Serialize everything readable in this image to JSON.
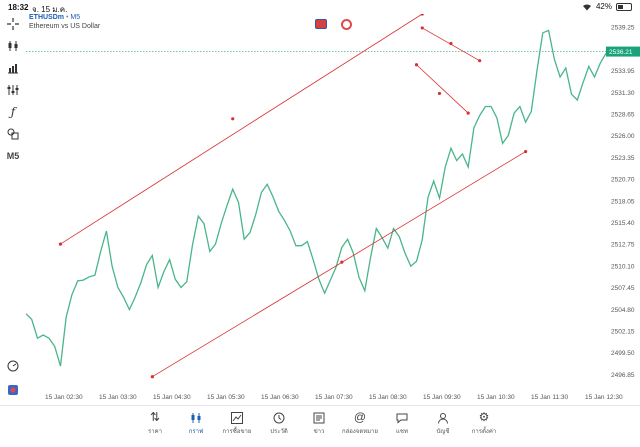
{
  "status_bar": {
    "time": "18:32",
    "date": "จ. 15 ม.ค.",
    "battery": "42%",
    "battery_level": 0.42
  },
  "header": {
    "symbol": "ETHUSDm",
    "separator": "•",
    "timeframe": "M5",
    "description": "Ethereum vs US Dollar"
  },
  "toolbar": {
    "items": [
      {
        "icon": "crosshair-icon"
      },
      {
        "icon": "candlestick-icon"
      },
      {
        "icon": "bar-chart-icon"
      },
      {
        "icon": "indicators-icon"
      },
      {
        "icon": "function-icon"
      },
      {
        "icon": "shapes-icon"
      },
      {
        "icon": "timeframe-label",
        "label": "M5"
      }
    ],
    "bottom_items": [
      {
        "icon": "speedometer-icon"
      },
      {
        "icon": "trading-toggle-icon"
      }
    ]
  },
  "price_label": "2536.21",
  "colors": {
    "line": "#49b58a",
    "trendline": "#d9302f",
    "price_tag": "#1aa37a",
    "accent": "#1a5fb4"
  },
  "chart_data": {
    "type": "line",
    "series": [
      {
        "values": [
          2504.2,
          2503.5,
          2501.2,
          2501.6,
          2501.2,
          2500.2,
          2497.8,
          2503.8,
          2506.5,
          2508.2,
          2508.3,
          2508.7,
          2508.9,
          2511.8,
          2514.3,
          2510.0,
          2507.4,
          2506.2,
          2504.7,
          2506.2,
          2508.0,
          2510.2,
          2511.3,
          2507.4,
          2509.3,
          2510.8,
          2508.4,
          2507.4,
          2508.1,
          2512.6,
          2516.1,
          2515.2,
          2511.8,
          2512.7,
          2515.2,
          2517.4,
          2519.4,
          2517.8,
          2513.3,
          2514.1,
          2516.3,
          2519.0,
          2520.0,
          2518.5,
          2516.7,
          2515.6,
          2514.3,
          2512.5,
          2512.5,
          2513.0,
          2510.8,
          2508.4,
          2506.7,
          2508.3,
          2509.9,
          2512.3,
          2513.3,
          2511.6,
          2508.6,
          2507.0,
          2511.1,
          2514.6,
          2513.5,
          2512.2,
          2514.6,
          2513.6,
          2511.6,
          2510.0,
          2510.6,
          2513.2,
          2518.4,
          2520.4,
          2518.3,
          2522.1,
          2524.4,
          2522.9,
          2523.7,
          2522.1,
          2526.9,
          2528.4,
          2529.5,
          2529.5,
          2528.1,
          2525.0,
          2526.0,
          2528.7,
          2529.5,
          2527.6,
          2528.9,
          2534.0,
          2538.5,
          2538.8,
          2535.3,
          2533.1,
          2534.2,
          2531.0,
          2530.3,
          2532.4,
          2534.4,
          2533.1,
          2534.8,
          2536.0
        ]
      }
    ],
    "ylim": [
      2495.0,
      2540.8
    ],
    "y_ticks": [
      "2539.25",
      "2536.55",
      "2533.95",
      "2531.30",
      "2528.65",
      "2526.00",
      "2523.35",
      "2520.70",
      "2518.05",
      "2515.40",
      "2512.75",
      "2510.10",
      "2507.45",
      "2504.80",
      "2502.15",
      "2499.50",
      "2496.85"
    ],
    "x_ticks": [
      "15 Jan 02:30",
      "15 Jan 03:30",
      "15 Jan 04:30",
      "15 Jan 05:30",
      "15 Jan 06:30",
      "15 Jan 07:30",
      "15 Jan 08:30",
      "15 Jan 09:30",
      "15 Jan 10:30",
      "15 Jan 11:30",
      "15 Jan 12:30"
    ],
    "current_price": 2536.21,
    "grid": false,
    "trendlines": [
      {
        "name": "channel-upper",
        "points": [
          [
            6,
            2512.7
          ],
          [
            36,
            2528.0
          ],
          [
            69,
            2540.8
          ]
        ]
      },
      {
        "name": "channel-lower",
        "points": [
          [
            22,
            2496.5
          ],
          [
            55,
            2510.5
          ],
          [
            87,
            2524.0
          ]
        ]
      },
      {
        "name": "peak-down-1",
        "points": [
          [
            69,
            2539.1
          ],
          [
            74,
            2537.2
          ],
          [
            79,
            2535.1
          ]
        ]
      },
      {
        "name": "peak-down-2",
        "points": [
          [
            68,
            2534.6
          ],
          [
            72,
            2531.1
          ],
          [
            77,
            2528.7
          ]
        ]
      }
    ]
  },
  "bottom_nav": {
    "items": [
      {
        "label": "ราคา",
        "icon": "quotes-icon"
      },
      {
        "label": "กราฟ",
        "icon": "chart-icon",
        "active": true
      },
      {
        "label": "การซื้อขาย",
        "icon": "trade-icon"
      },
      {
        "label": "ประวัติ",
        "icon": "history-icon"
      },
      {
        "label": "ข่าว",
        "icon": "news-icon"
      },
      {
        "label": "กล่องจดหมาย",
        "icon": "mailbox-icon"
      },
      {
        "label": "แชท",
        "icon": "chat-icon"
      },
      {
        "label": "บัญชี",
        "icon": "account-icon"
      },
      {
        "label": "การตั้งค่า",
        "icon": "settings-icon"
      }
    ]
  }
}
